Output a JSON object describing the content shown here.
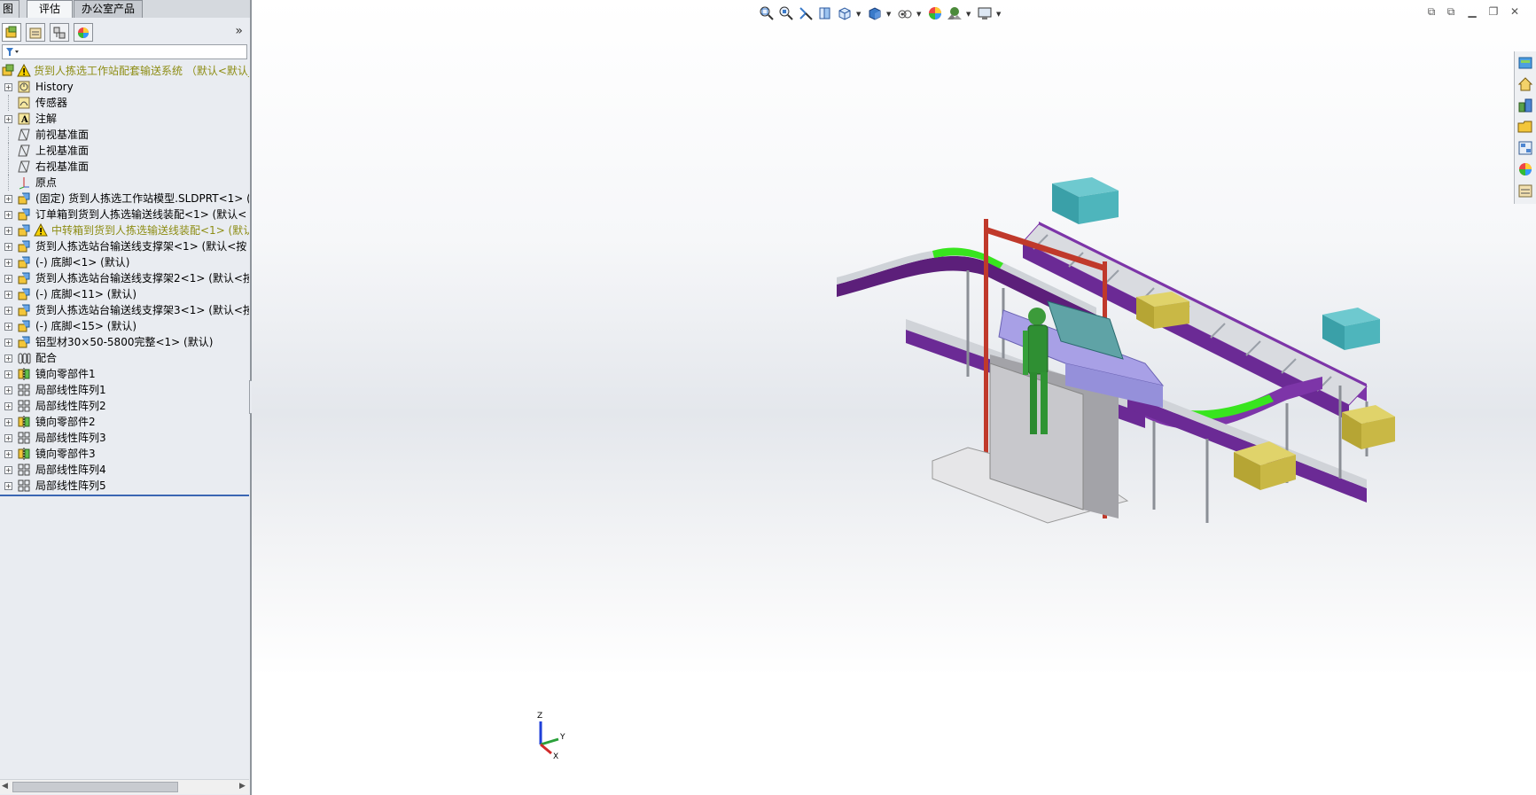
{
  "tabs": [
    {
      "label": "图"
    },
    {
      "label": "评估"
    },
    {
      "label": "办公室产品"
    }
  ],
  "panel": {
    "expand_glyph": "»",
    "filter_icon": "filter-icon"
  },
  "tree": {
    "root": {
      "label": "货到人拣选工作站配套输送系统 （默认<默认_",
      "icon": "assembly-icon",
      "warning": true
    },
    "items": [
      {
        "label": "History",
        "icon": "history-icon",
        "expand": true
      },
      {
        "label": "传感器",
        "icon": "sensor-icon",
        "expand": false
      },
      {
        "label": "注解",
        "icon": "annotation-icon",
        "expand": true
      },
      {
        "label": "前视基准面",
        "icon": "plane-icon",
        "expand": false
      },
      {
        "label": "上视基准面",
        "icon": "plane-icon",
        "expand": false
      },
      {
        "label": "右视基准面",
        "icon": "plane-icon",
        "expand": false
      },
      {
        "label": "原点",
        "icon": "origin-icon",
        "expand": false
      },
      {
        "label": "(固定) 货到人拣选工作站模型.SLDPRT<1> (",
        "icon": "part-icon",
        "expand": true
      },
      {
        "label": "订单箱到货到人拣选输送线装配<1> (默认<",
        "icon": "subassembly-icon",
        "expand": true
      },
      {
        "label": "中转箱到货到人拣选输送线装配<1> (默认",
        "icon": "subassembly-icon",
        "expand": true,
        "warning": true
      },
      {
        "label": "货到人拣选站台输送线支撑架<1> (默认<按",
        "icon": "subassembly-icon",
        "expand": true
      },
      {
        "label": "(-) 底脚<1> (默认)",
        "icon": "subassembly-icon",
        "expand": true
      },
      {
        "label": "货到人拣选站台输送线支撑架2<1> (默认<按",
        "icon": "subassembly-icon",
        "expand": true
      },
      {
        "label": "(-) 底脚<11> (默认)",
        "icon": "subassembly-icon",
        "expand": true
      },
      {
        "label": "货到人拣选站台输送线支撑架3<1> (默认<按",
        "icon": "subassembly-icon",
        "expand": true
      },
      {
        "label": "(-) 底脚<15> (默认)",
        "icon": "subassembly-icon",
        "expand": true
      },
      {
        "label": "铝型材30×50-5800完整<1> (默认)",
        "icon": "subassembly-icon",
        "expand": true
      },
      {
        "label": "配合",
        "icon": "mates-icon",
        "expand": true
      },
      {
        "label": "镜向零部件1",
        "icon": "mirror-icon",
        "expand": true
      },
      {
        "label": "局部线性阵列1",
        "icon": "pattern-icon",
        "expand": true
      },
      {
        "label": "局部线性阵列2",
        "icon": "pattern-icon",
        "expand": true
      },
      {
        "label": "镜向零部件2",
        "icon": "mirror-icon",
        "expand": true
      },
      {
        "label": "局部线性阵列3",
        "icon": "pattern-icon",
        "expand": true
      },
      {
        "label": "镜向零部件3",
        "icon": "mirror-icon",
        "expand": true
      },
      {
        "label": "局部线性阵列4",
        "icon": "pattern-icon",
        "expand": true
      },
      {
        "label": "局部线性阵列5",
        "icon": "pattern-icon",
        "expand": true
      }
    ]
  },
  "viewport": {
    "triad": {
      "z": "Z",
      "x": "X",
      "y": "Y"
    },
    "heads_up_icons": [
      "zoom-to-fit-icon",
      "zoom-area-icon",
      "previous-view-icon",
      "section-view-icon",
      "view-orientation-icon",
      "display-style-icon",
      "hide-show-icon",
      "appearance-icon",
      "scene-icon",
      "view-settings-icon"
    ],
    "taskpane_icons": [
      "resources-icon",
      "home-icon",
      "design-library-icon",
      "file-explorer-icon",
      "view-palette-icon",
      "appearances-icon",
      "custom-properties-icon"
    ]
  },
  "colors": {
    "panel_bg": "#e9ecf1",
    "warning_text": "#8d8d14",
    "selection_line": "#3a66b3"
  }
}
